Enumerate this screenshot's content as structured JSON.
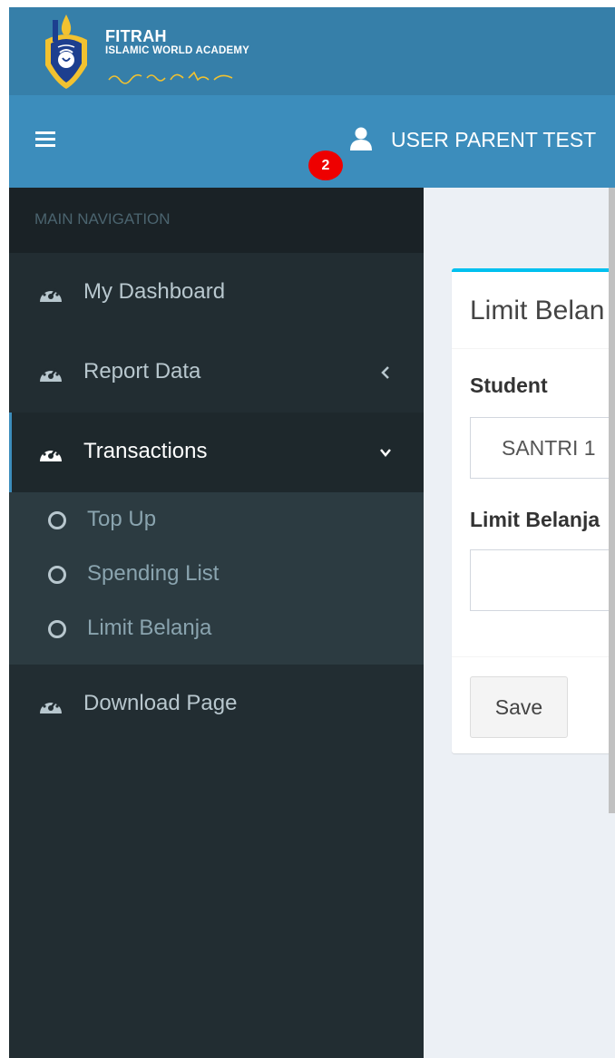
{
  "brand": {
    "title": "FITRAH",
    "subtitle": "ISLAMIC WORLD ACADEMY",
    "logo_icon": "fitrah-emblem-icon"
  },
  "navbar": {
    "menu_icon": "hamburger-icon",
    "user_name": "USER PARENT TEST",
    "user_icon": "user-icon",
    "notification_count": "2",
    "colors": {
      "logo_bar": "#367fa9",
      "navbar": "#3c8dbc",
      "badge": "#ee0000"
    }
  },
  "sidebar": {
    "header": "MAIN NAVIGATION",
    "items": [
      {
        "label": "My Dashboard",
        "icon": "dashboard-icon"
      },
      {
        "label": "Report Data",
        "icon": "dashboard-icon",
        "chevron": "chevron-left-icon"
      },
      {
        "label": "Transactions",
        "icon": "dashboard-icon",
        "chevron": "chevron-down-icon",
        "active": true
      },
      {
        "label": "Download Page",
        "icon": "dashboard-icon"
      }
    ],
    "submenu": [
      {
        "label": "Top Up",
        "icon": "circle-icon"
      },
      {
        "label": "Spending List",
        "icon": "circle-icon"
      },
      {
        "label": "Limit Belanja",
        "icon": "circle-icon"
      }
    ],
    "colors": {
      "background": "#222d32",
      "active": "#1e282c",
      "submenu": "#2c3b41"
    }
  },
  "content": {
    "box_title": "Limit Belan",
    "student_label": "Student",
    "student_value": "SANTRI 1",
    "limit_label": "Limit Belanja",
    "limit_value": "",
    "save_label": "Save",
    "accent": "#00c0ef"
  }
}
